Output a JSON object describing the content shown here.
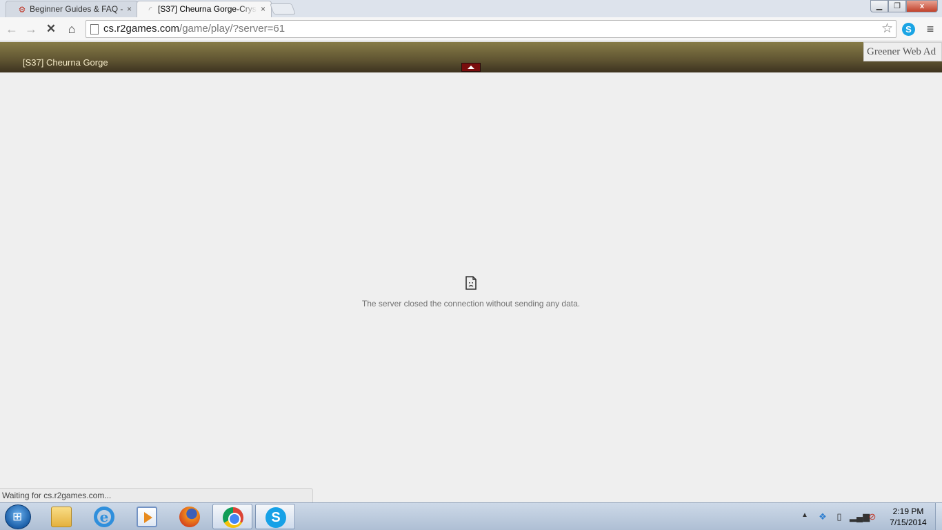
{
  "browser": {
    "tabs": [
      {
        "label": "Beginner Guides & FAQ -",
        "icon": "r2-logo-icon",
        "close": "×"
      },
      {
        "label": "[S37] Cheurna Gorge-Crys",
        "icon": "loading-spinner-icon",
        "close": "×"
      }
    ],
    "window_controls": {
      "minimize": "▁",
      "maximize": "❐",
      "close": "x"
    },
    "toolbar": {
      "back": "←",
      "forward": "→",
      "stop": "✕",
      "home": "⌂",
      "url_domain": "cs.r2games.com",
      "url_path": "/game/play/?server=61",
      "star": "☆",
      "skype_ext": "S",
      "menu": "≡"
    }
  },
  "game_header": {
    "title": "[S37] Cheurna Gorge",
    "ad_text": "Greener Web Ad"
  },
  "error": {
    "message": "The server closed the connection without sending any data."
  },
  "status_bar": {
    "text": "Waiting for cs.r2games.com..."
  },
  "taskbar": {
    "start_glyph": "⊞",
    "apps": [
      {
        "name": "windows-explorer",
        "active": false
      },
      {
        "name": "internet-explorer",
        "glyph": "e",
        "active": false
      },
      {
        "name": "media-player",
        "active": false
      },
      {
        "name": "firefox",
        "active": false
      },
      {
        "name": "chrome",
        "active": true
      },
      {
        "name": "skype",
        "glyph": "S",
        "active": true
      }
    ],
    "tray": {
      "arrow": "▲",
      "icons": [
        "dropbox-icon",
        "battery-icon",
        "signal-icon",
        "volume-muted-icon"
      ]
    },
    "time": "2:19 PM",
    "date": "7/15/2014"
  },
  "colors": {
    "header_band": "#625733",
    "header_title": "#f3e9c7",
    "collapse_button": "#7a0d0d",
    "error_text": "#737373",
    "page_bg": "#efefef"
  }
}
